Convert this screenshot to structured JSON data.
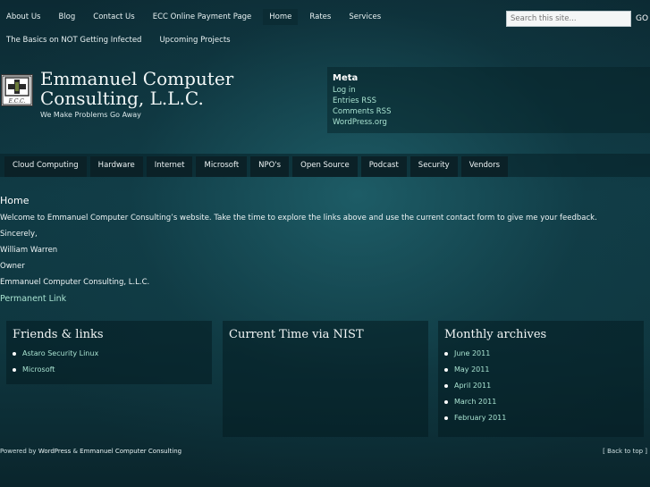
{
  "top_nav": {
    "items": [
      "About Us",
      "Blog",
      "Contact Us",
      "ECC Online Payment Page",
      "Home",
      "Rates",
      "Services",
      "The Basics on NOT Getting Infected",
      "Upcoming Projects"
    ],
    "active": "Home"
  },
  "search": {
    "placeholder": "Search this site...",
    "go_label": "GO"
  },
  "header": {
    "title_line1": "Emmanuel Computer",
    "title_line2": "Consulting, L.L.C.",
    "tagline": "We Make Problems Go Away",
    "logo_text": "E.C.C."
  },
  "meta": {
    "heading": "Meta",
    "links": [
      "Log in",
      "Entries RSS",
      "Comments RSS",
      "WordPress.org"
    ]
  },
  "category_nav": [
    "Cloud Computing",
    "Hardware",
    "Internet",
    "Microsoft",
    "NPO's",
    "Open Source",
    "Podcast",
    "Security",
    "Vendors"
  ],
  "post": {
    "title": "Home",
    "paragraphs": [
      "Welcome to Emmanuel Computer Consulting’s website.    Take the time to explore the links above and use the current contact form to give me your feedback.",
      "Sincerely,",
      "William Warren",
      "Owner",
      "Emmanuel Computer Consulting, L.L.C."
    ],
    "permalink": "Permanent Link"
  },
  "widgets": {
    "friends": {
      "title": "Friends & links",
      "links": [
        "Astaro Security Linux",
        "Microsoft"
      ]
    },
    "time": {
      "title": "Current Time via NIST"
    },
    "archives": {
      "title": "Monthly archives",
      "links": [
        "June 2011",
        "May 2011",
        "April 2011",
        "March 2011",
        "February 2011"
      ]
    }
  },
  "footer": {
    "powered_prefix": "Powered by",
    "wordpress": "WordPress",
    "amp": "&",
    "site": "Emmanuel Computer Consulting",
    "back_to_top": "[ Back to top ]"
  },
  "colors": {
    "link": "#a8e2d0",
    "background": "#103a44",
    "active_nav": "#0b2c34"
  }
}
